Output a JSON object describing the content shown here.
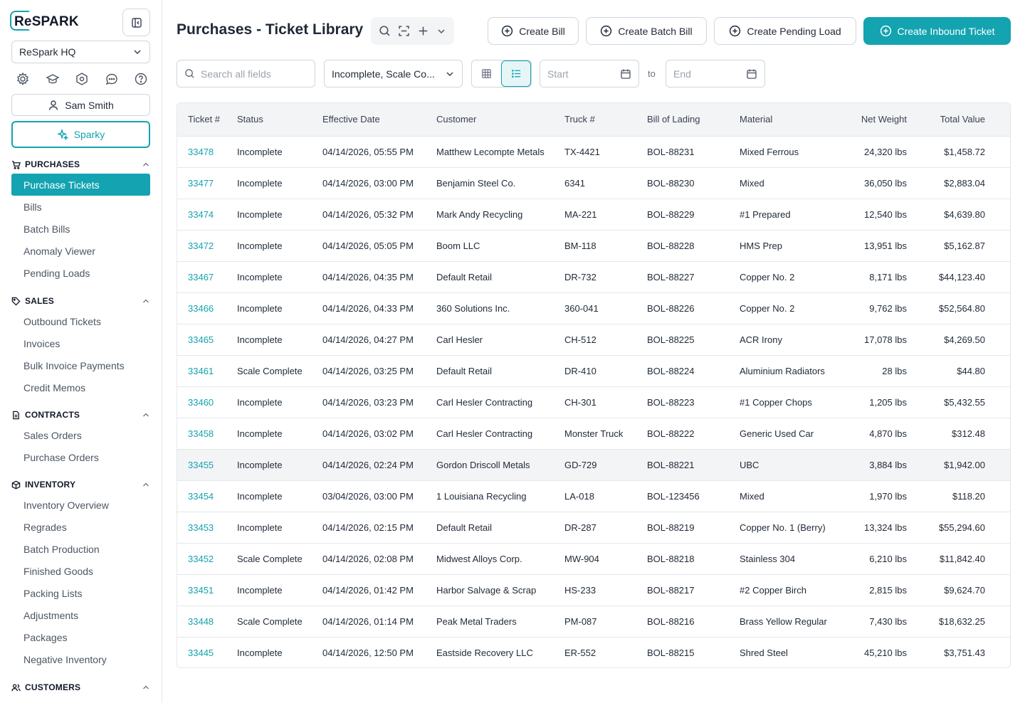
{
  "brand": {
    "logo_text": "ReSPARK",
    "accent": "#14a3b0"
  },
  "sidebar": {
    "org_select": "ReSpark HQ",
    "top_icons": [
      "gear-icon",
      "graduation-cap-icon",
      "hexagon-icon",
      "chat-icon",
      "help-icon"
    ],
    "user_name": "Sam Smith",
    "sparky_label": "Sparky",
    "sections": [
      {
        "title": "PURCHASES",
        "icon": "cart-icon",
        "items": [
          "Purchase Tickets",
          "Bills",
          "Batch Bills",
          "Anomaly Viewer",
          "Pending Loads"
        ],
        "active": 0
      },
      {
        "title": "SALES",
        "icon": "tag-icon",
        "items": [
          "Outbound Tickets",
          "Invoices",
          "Bulk Invoice Payments",
          "Credit Memos"
        ]
      },
      {
        "title": "CONTRACTS",
        "icon": "document-icon",
        "items": [
          "Sales Orders",
          "Purchase Orders"
        ]
      },
      {
        "title": "INVENTORY",
        "icon": "box-icon",
        "items": [
          "Inventory Overview",
          "Regrades",
          "Batch Production",
          "Finished Goods",
          "Packing Lists",
          "Adjustments",
          "Packages",
          "Negative Inventory"
        ]
      },
      {
        "title": "CUSTOMERS",
        "icon": "users-icon",
        "items": []
      }
    ]
  },
  "header": {
    "title": "Purchases - Ticket Library",
    "buttons": {
      "create_bill": "Create Bill",
      "create_batch_bill": "Create Batch Bill",
      "create_pending_load": "Create Pending Load",
      "create_inbound_ticket": "Create Inbound Ticket"
    }
  },
  "filters": {
    "search_placeholder": "Search all fields",
    "status_filter": "Incomplete, Scale Co...",
    "start_placeholder": "Start",
    "to_label": "to",
    "end_placeholder": "End"
  },
  "table": {
    "columns": [
      "Ticket #",
      "Status",
      "Effective Date",
      "Customer",
      "Truck #",
      "Bill of Lading",
      "Material",
      "Net Weight",
      "Total Value"
    ],
    "rows": [
      [
        "33478",
        "Incomplete",
        "04/14/2026, 05:55 PM",
        "Matthew Lecompte Metals",
        "TX-4421",
        "BOL-88231",
        "Mixed Ferrous",
        "24,320 lbs",
        "$1,458.72"
      ],
      [
        "33477",
        "Incomplete",
        "04/14/2026, 03:00 PM",
        "Benjamin Steel Co.",
        "6341",
        "BOL-88230",
        "Mixed",
        "36,050 lbs",
        "$2,883.04"
      ],
      [
        "33474",
        "Incomplete",
        "04/14/2026, 05:32 PM",
        "Mark Andy Recycling",
        "MA-221",
        "BOL-88229",
        "#1 Prepared",
        "12,540 lbs",
        "$4,639.80"
      ],
      [
        "33472",
        "Incomplete",
        "04/14/2026, 05:05 PM",
        "Boom LLC",
        "BM-118",
        "BOL-88228",
        "HMS Prep",
        "13,951 lbs",
        "$5,162.87"
      ],
      [
        "33467",
        "Incomplete",
        "04/14/2026, 04:35 PM",
        "Default Retail",
        "DR-732",
        "BOL-88227",
        "Copper No. 2",
        "8,171 lbs",
        "$44,123.40"
      ],
      [
        "33466",
        "Incomplete",
        "04/14/2026, 04:33 PM",
        "360 Solutions Inc.",
        "360-041",
        "BOL-88226",
        "Copper No. 2",
        "9,762 lbs",
        "$52,564.80"
      ],
      [
        "33465",
        "Incomplete",
        "04/14/2026, 04:27 PM",
        "Carl Hesler",
        "CH-512",
        "BOL-88225",
        "ACR Irony",
        "17,078 lbs",
        "$4,269.50"
      ],
      [
        "33461",
        "Scale Complete",
        "04/14/2026, 03:25 PM",
        "Default Retail",
        "DR-410",
        "BOL-88224",
        "Aluminium Radiators",
        "28 lbs",
        "$44.80"
      ],
      [
        "33460",
        "Incomplete",
        "04/14/2026, 03:23 PM",
        "Carl Hesler Contracting",
        "CH-301",
        "BOL-88223",
        "#1 Copper Chops",
        "1,205 lbs",
        "$5,432.55"
      ],
      [
        "33458",
        "Incomplete",
        "04/14/2026, 03:02 PM",
        "Carl Hesler Contracting",
        "Monster Truck",
        "BOL-88222",
        "Generic Used Car",
        "4,870 lbs",
        "$312.48"
      ],
      [
        "33455",
        "Incomplete",
        "04/14/2026, 02:24 PM",
        "Gordon Driscoll Metals",
        "GD-729",
        "BOL-88221",
        "UBC",
        "3,884 lbs",
        "$1,942.00"
      ],
      [
        "33454",
        "Incomplete",
        "03/04/2026, 03:00 PM",
        "1 Louisiana Recycling",
        "LA-018",
        "BOL-123456",
        "Mixed",
        "1,970 lbs",
        "$118.20"
      ],
      [
        "33453",
        "Incomplete",
        "04/14/2026, 02:15 PM",
        "Default Retail",
        "DR-287",
        "BOL-88219",
        "Copper No. 1 (Berry)",
        "13,324 lbs",
        "$55,294.60"
      ],
      [
        "33452",
        "Scale Complete",
        "04/14/2026, 02:08 PM",
        "Midwest Alloys Corp.",
        "MW-904",
        "BOL-88218",
        "Stainless 304",
        "6,210 lbs",
        "$11,842.40"
      ],
      [
        "33451",
        "Incomplete",
        "04/14/2026, 01:42 PM",
        "Harbor Salvage & Scrap",
        "HS-233",
        "BOL-88217",
        "#2 Copper Birch",
        "2,815 lbs",
        "$9,624.70"
      ],
      [
        "33448",
        "Scale Complete",
        "04/14/2026, 01:14 PM",
        "Peak Metal Traders",
        "PM-087",
        "BOL-88216",
        "Brass Yellow Regular",
        "7,430 lbs",
        "$18,632.25"
      ],
      [
        "33445",
        "Incomplete",
        "04/14/2026, 12:50 PM",
        "Eastside Recovery LLC",
        "ER-552",
        "BOL-88215",
        "Shred Steel",
        "45,210 lbs",
        "$3,751.43"
      ]
    ],
    "highlighted_row": 10
  }
}
